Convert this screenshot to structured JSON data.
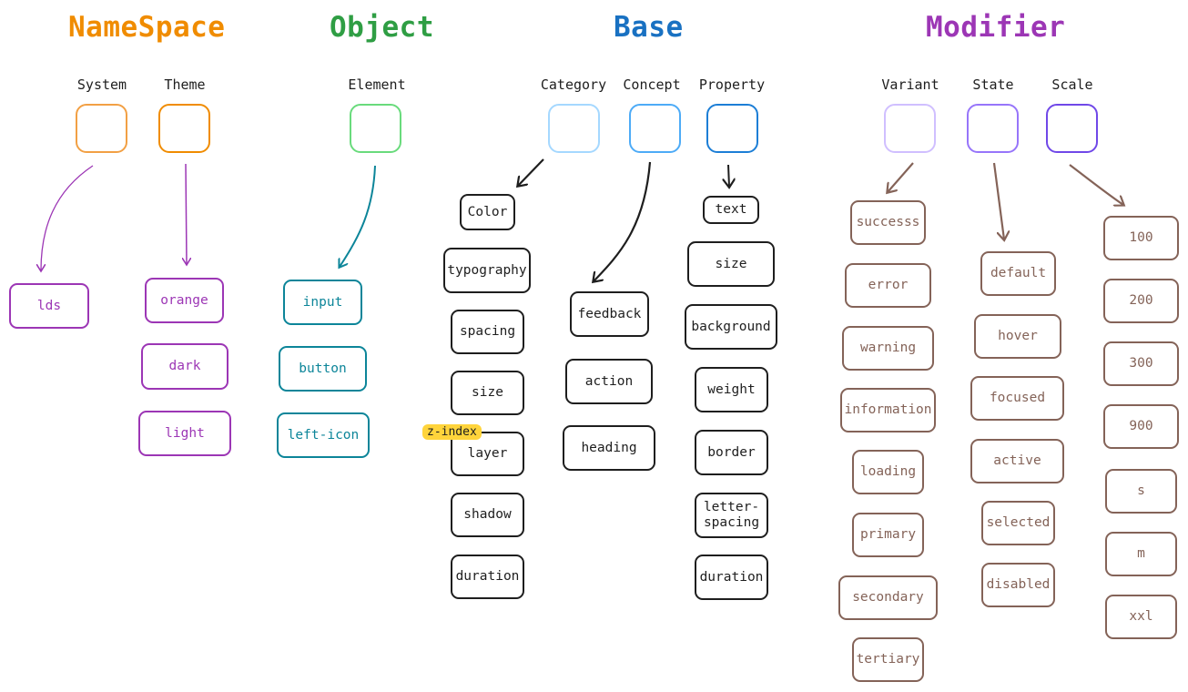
{
  "headings": {
    "namespace": "NameSpace",
    "object": "Object",
    "base": "Base",
    "modifier": "Modifier"
  },
  "colors": {
    "namespace": "#f08c00",
    "object": "#2f9e44",
    "base": "#1971c2",
    "modifier": "#9c36b5",
    "purple_node": "#9c36b5",
    "teal_node": "#0c8599",
    "brown_node": "#846358",
    "black_node": "#1e1e1e",
    "badge": "#ffd43b"
  },
  "slots": {
    "system": {
      "label": "System",
      "color": "#f2a044"
    },
    "theme": {
      "label": "Theme",
      "color": "#f08c00"
    },
    "element": {
      "label": "Element",
      "color": "#69db7c"
    },
    "category": {
      "label": "Category",
      "color": "#a5d8ff"
    },
    "concept": {
      "label": "Concept",
      "color": "#4dabf7"
    },
    "property": {
      "label": "Property",
      "color": "#1c7ed6"
    },
    "variant": {
      "label": "Variant",
      "color": "#d0bfff"
    },
    "state": {
      "label": "State",
      "color": "#9775fa"
    },
    "scale": {
      "label": "Scale",
      "color": "#7048e8"
    }
  },
  "system_items": [
    "lds"
  ],
  "theme_items": [
    "orange",
    "dark",
    "light"
  ],
  "element_items": [
    "input",
    "button",
    "left-icon"
  ],
  "category_items": [
    "Color",
    "typography",
    "spacing",
    "size",
    "layer",
    "shadow",
    "duration"
  ],
  "concept_items": [
    "feedback",
    "action",
    "heading"
  ],
  "property_items": [
    "text",
    "size",
    "background",
    "weight",
    "border",
    "letter-spacing",
    "duration"
  ],
  "variant_items": [
    "successs",
    "error",
    "warning",
    "information",
    "loading",
    "primary",
    "secondary",
    "tertiary"
  ],
  "state_items": [
    "default",
    "hover",
    "focused",
    "active",
    "selected",
    "disabled"
  ],
  "scale_items": [
    "100",
    "200",
    "300",
    "900",
    "s",
    "m",
    "xxl"
  ],
  "badge_text": "z-index"
}
